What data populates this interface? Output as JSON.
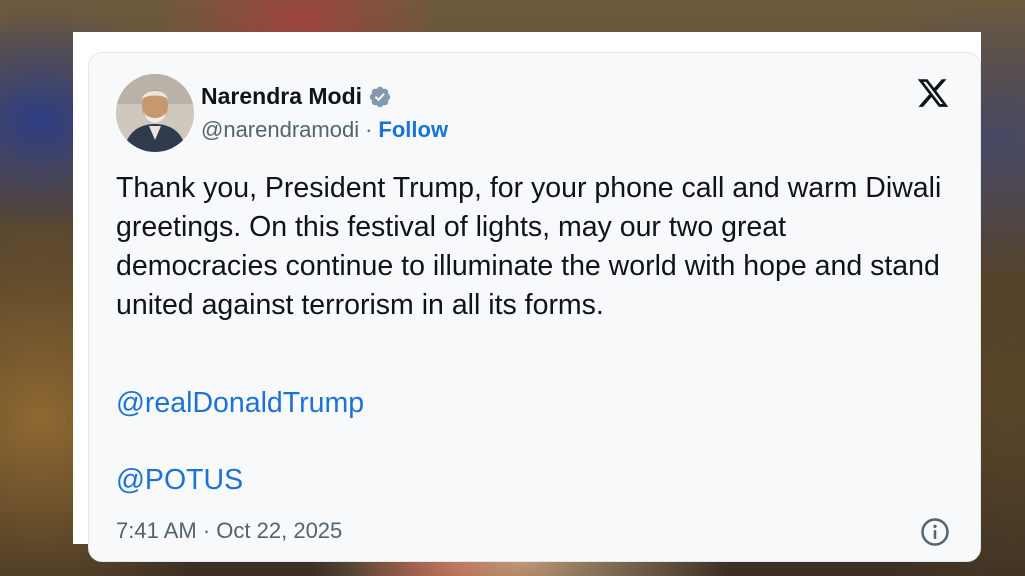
{
  "tweet": {
    "author_name": "Narendra Modi",
    "handle": "@narendramodi",
    "separator": "·",
    "follow_label": "Follow",
    "text": "Thank you, President Trump, for your phone call and warm Diwali greetings. On this festival of lights, may our two great democracies continue to illuminate the world with hope and stand united against terrorism in all its forms.",
    "mentions": [
      "@realDonaldTrump",
      "@POTUS"
    ],
    "time": "7:41 AM",
    "date": "Oct 22, 2025"
  },
  "icons": {
    "verified": "verified-badge-icon",
    "platform_logo": "x-logo-icon",
    "info": "info-icon"
  },
  "colors": {
    "link": "#1d72d6",
    "verified_badge": "#829aab",
    "secondary_text": "#536471",
    "primary_text": "#0f1419",
    "card_background": "#f7f9fa"
  }
}
